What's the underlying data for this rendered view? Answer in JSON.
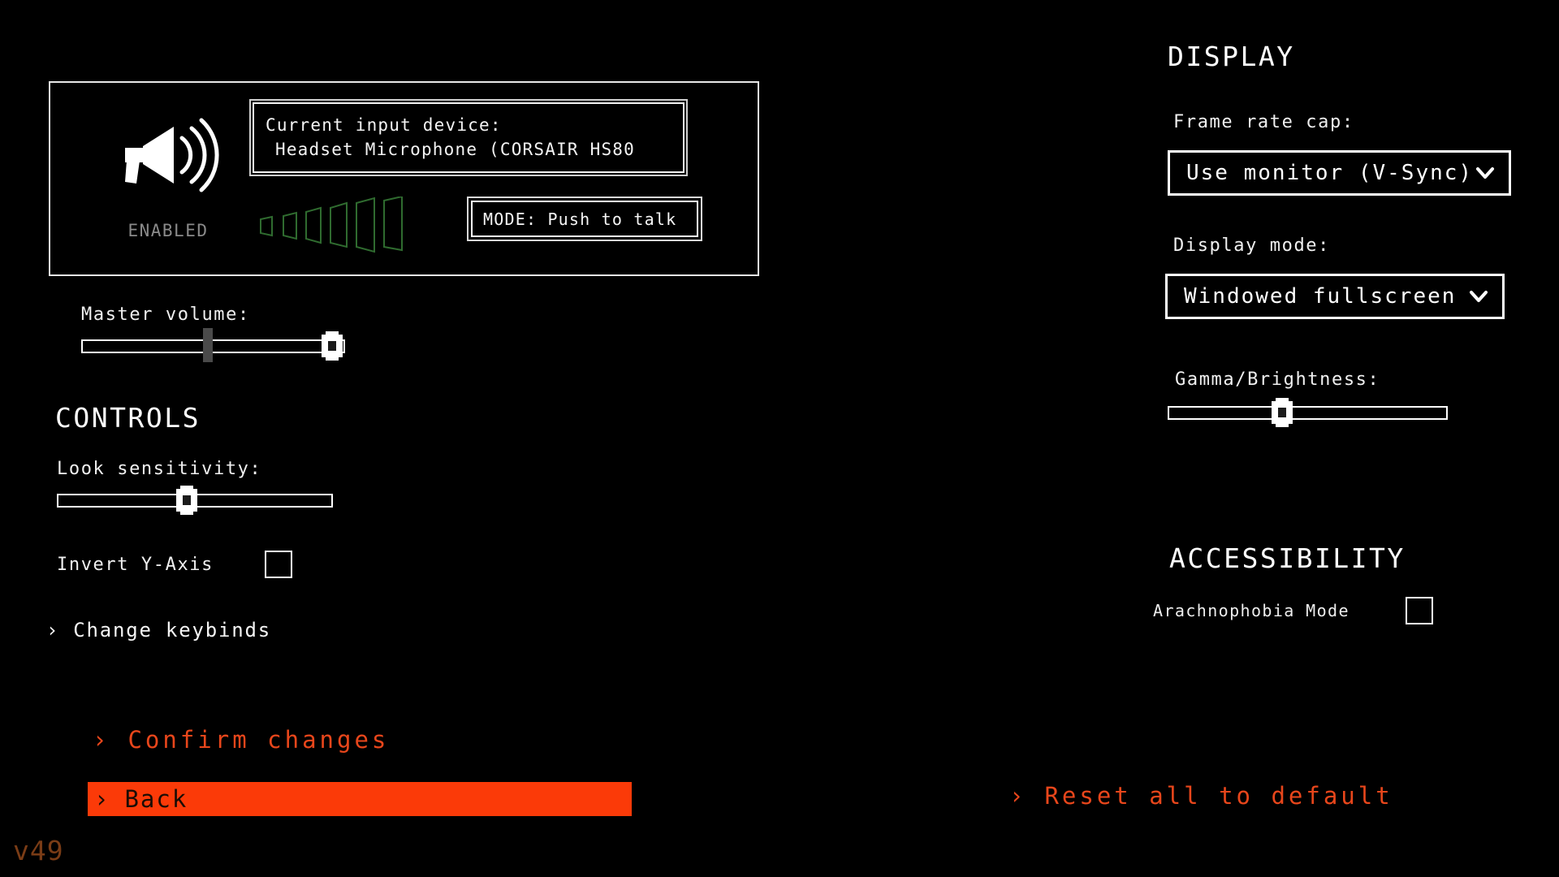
{
  "audio": {
    "enabled_label": "ENABLED",
    "mic_icon": "megaphone-icon",
    "device_label": "Current input device:",
    "device_value": "Headset Microphone (CORSAIR HS80",
    "mode_text": "MODE: Push to talk",
    "vu_meter_bars": 6,
    "master_volume_label": "Master volume:",
    "master_volume_percent": 95,
    "master_volume_tick_percent": 48
  },
  "controls": {
    "heading": "CONTROLS",
    "look_sensitivity_label": "Look sensitivity:",
    "look_sensitivity_percent": 47,
    "invert_y_label": "Invert Y-Axis",
    "invert_y_checked": false,
    "change_keybinds_label": "Change keybinds",
    "chevron": "›"
  },
  "display": {
    "heading": "DISPLAY",
    "frame_rate_label": "Frame rate cap:",
    "frame_rate_value": "Use monitor (V-Sync)",
    "display_mode_label": "Display mode:",
    "display_mode_value": "Windowed fullscreen",
    "gamma_label": "Gamma/Brightness:",
    "gamma_percent": 41
  },
  "accessibility": {
    "heading": "ACCESSIBILITY",
    "arachnophobia_label": "Arachnophobia Mode",
    "arachnophobia_checked": false
  },
  "actions": {
    "confirm_label": "Confirm changes",
    "back_label": "Back",
    "reset_label": "Reset all to default",
    "chevron": "›"
  },
  "footer": {
    "version": "v49"
  },
  "colors": {
    "background": "#000000",
    "foreground": "#ffffff",
    "accent_orange": "#e8461b",
    "highlight_bg": "#fb3a08",
    "highlight_text": "#1a0d06",
    "version_text": "#7a3c16",
    "muted": "#8a8a8a",
    "vu_green": "#2e5c2e"
  }
}
